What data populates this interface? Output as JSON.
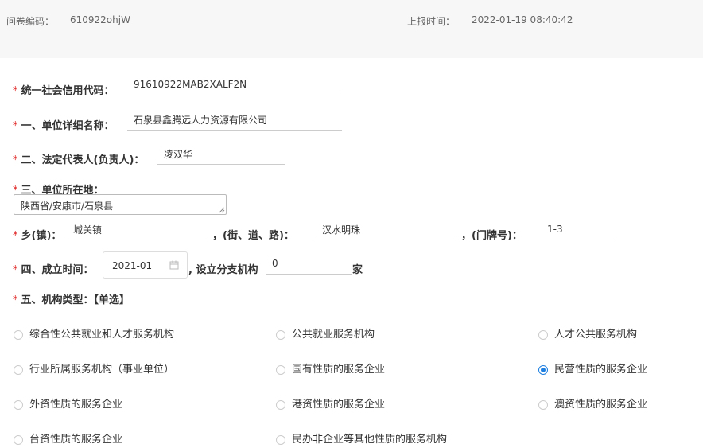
{
  "header": {
    "code_label": "问卷编码：",
    "code_value": "610922ohjW",
    "time_label": "上报时间：",
    "time_value": "2022-01-19 08:40:42"
  },
  "form": {
    "required_mark": "*",
    "credit_code": {
      "label": "统一社会信用代码：",
      "value": "91610922MAB2XALF2N"
    },
    "unit_name": {
      "label": "一、单位详细名称：",
      "value": "石泉县鑫腾远人力资源有限公司"
    },
    "legal_rep": {
      "label": "二、法定代表人(负责人)：",
      "value": "凌双华"
    },
    "location": {
      "label": "三、单位所在地：",
      "value": "陕西省/安康市/石泉县"
    },
    "town": {
      "label": "乡(镇)：",
      "value": "城关镇"
    },
    "street": {
      "label": "，(街、道、路)：",
      "value": "汉水明珠"
    },
    "house_no": {
      "label": "，(门牌号)：",
      "value": "1-3"
    },
    "established": {
      "label": "四、成立时间：",
      "value": "2021-01",
      "icon": "calendar-icon"
    },
    "branches": {
      "label": ", 设立分支机构",
      "value": "0",
      "unit": "家"
    },
    "org_type": {
      "label": "五、机构类型：【单选】",
      "options": [
        {
          "label": "综合性公共就业和人才服务机构",
          "selected": false
        },
        {
          "label": "公共就业服务机构",
          "selected": false
        },
        {
          "label": "人才公共服务机构",
          "selected": false
        },
        {
          "label": "行业所属服务机构（事业单位）",
          "selected": false
        },
        {
          "label": "国有性质的服务企业",
          "selected": false
        },
        {
          "label": "民营性质的服务企业",
          "selected": true
        },
        {
          "label": "外资性质的服务企业",
          "selected": false
        },
        {
          "label": "港资性质的服务企业",
          "selected": false
        },
        {
          "label": "澳资性质的服务企业",
          "selected": false
        },
        {
          "label": "台资性质的服务企业",
          "selected": false
        },
        {
          "label": "民办非企业等其他性质的服务机构",
          "selected": false
        }
      ]
    }
  },
  "colors": {
    "required": "#e02020",
    "radio_selected": "#1e7fe0",
    "header_bg": "#f7f7f8"
  }
}
